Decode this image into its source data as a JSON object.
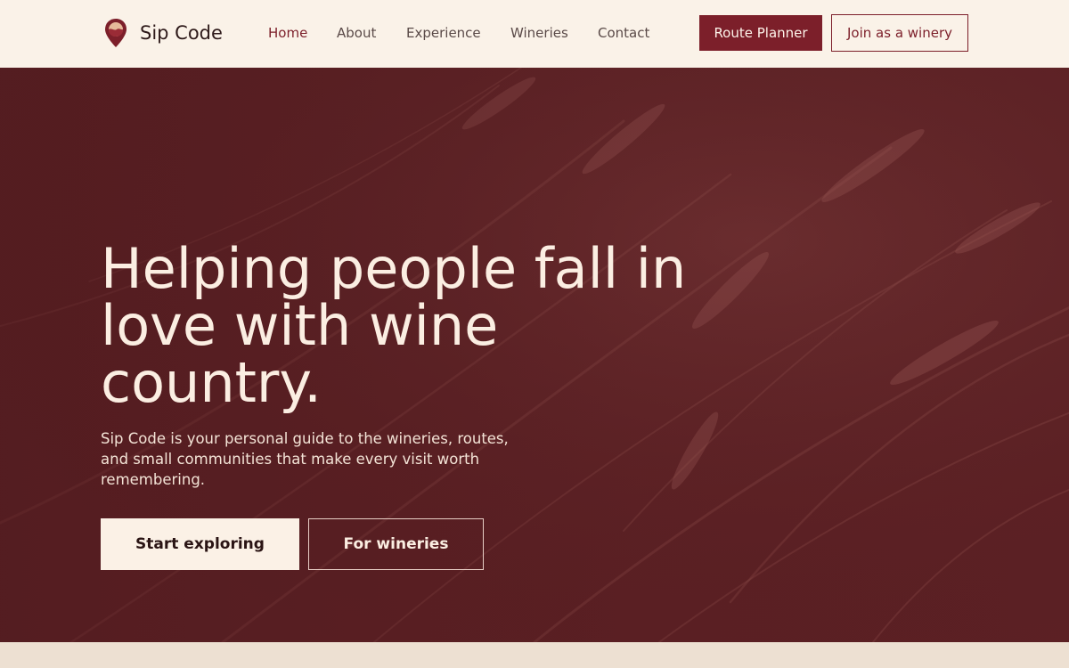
{
  "header": {
    "brand": "Sip Code",
    "logo_icon": "map-pin-wine-icon",
    "nav": [
      {
        "label": "Home",
        "active": true
      },
      {
        "label": "About",
        "active": false
      },
      {
        "label": "Experience",
        "active": false
      },
      {
        "label": "Wineries",
        "active": false
      },
      {
        "label": "Contact",
        "active": false
      }
    ],
    "route_planner_label": "Route Planner",
    "join_label": "Join as a winery"
  },
  "hero": {
    "title": "Helping people fall in love with wine country.",
    "subtitle": "Sip Code is your personal guide to the wineries, routes, and small communities that make every visit worth remembering.",
    "primary_cta": "Start exploring",
    "secondary_cta": "For wineries"
  },
  "colors": {
    "accent": "#7c1f2a",
    "header_bg": "#faf2e8",
    "hero_bg": "#5c2024",
    "light_text": "#fbeee2"
  }
}
